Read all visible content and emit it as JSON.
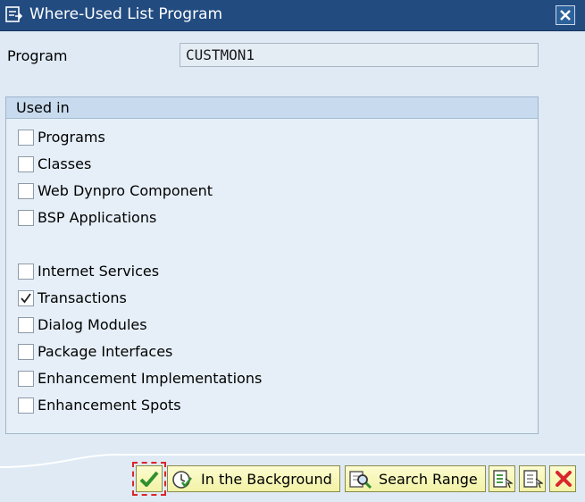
{
  "window": {
    "title": "Where-Used List Program",
    "title_icon": "window-icon",
    "close_icon": "close-icon"
  },
  "program": {
    "label": "Program",
    "value": "CUSTMON1"
  },
  "used_in": {
    "title": "Used in",
    "options": [
      {
        "label": "Programs",
        "checked": false
      },
      {
        "label": "Classes",
        "checked": false
      },
      {
        "label": "Web Dynpro Component",
        "checked": false
      },
      {
        "label": "BSP Applications",
        "checked": false
      },
      {
        "label": "Internet Services",
        "checked": false
      },
      {
        "label": "Transactions",
        "checked": true
      },
      {
        "label": "Dialog Modules",
        "checked": false
      },
      {
        "label": "Package Interfaces",
        "checked": false
      },
      {
        "label": "Enhancement Implementations",
        "checked": false
      },
      {
        "label": "Enhancement Spots",
        "checked": false
      }
    ]
  },
  "toolbar": {
    "continue_icon": "checkmark-icon",
    "background_label": "In the Background",
    "background_icon": "clock-checkmark-icon",
    "search_range_label": "Search Range",
    "search_range_icon": "magnifier-icon",
    "select_all_icon": "select-all-icon",
    "deselect_all_icon": "deselect-all-icon",
    "cancel_icon": "cancel-x-icon"
  },
  "colors": {
    "title_bar": "#224b80",
    "background": "#dfeaf5",
    "group_header": "#c8dbee",
    "button_face": "#f2f2a6",
    "cancel_red": "#d9262c",
    "confirm_green": "#2f8f2f"
  }
}
